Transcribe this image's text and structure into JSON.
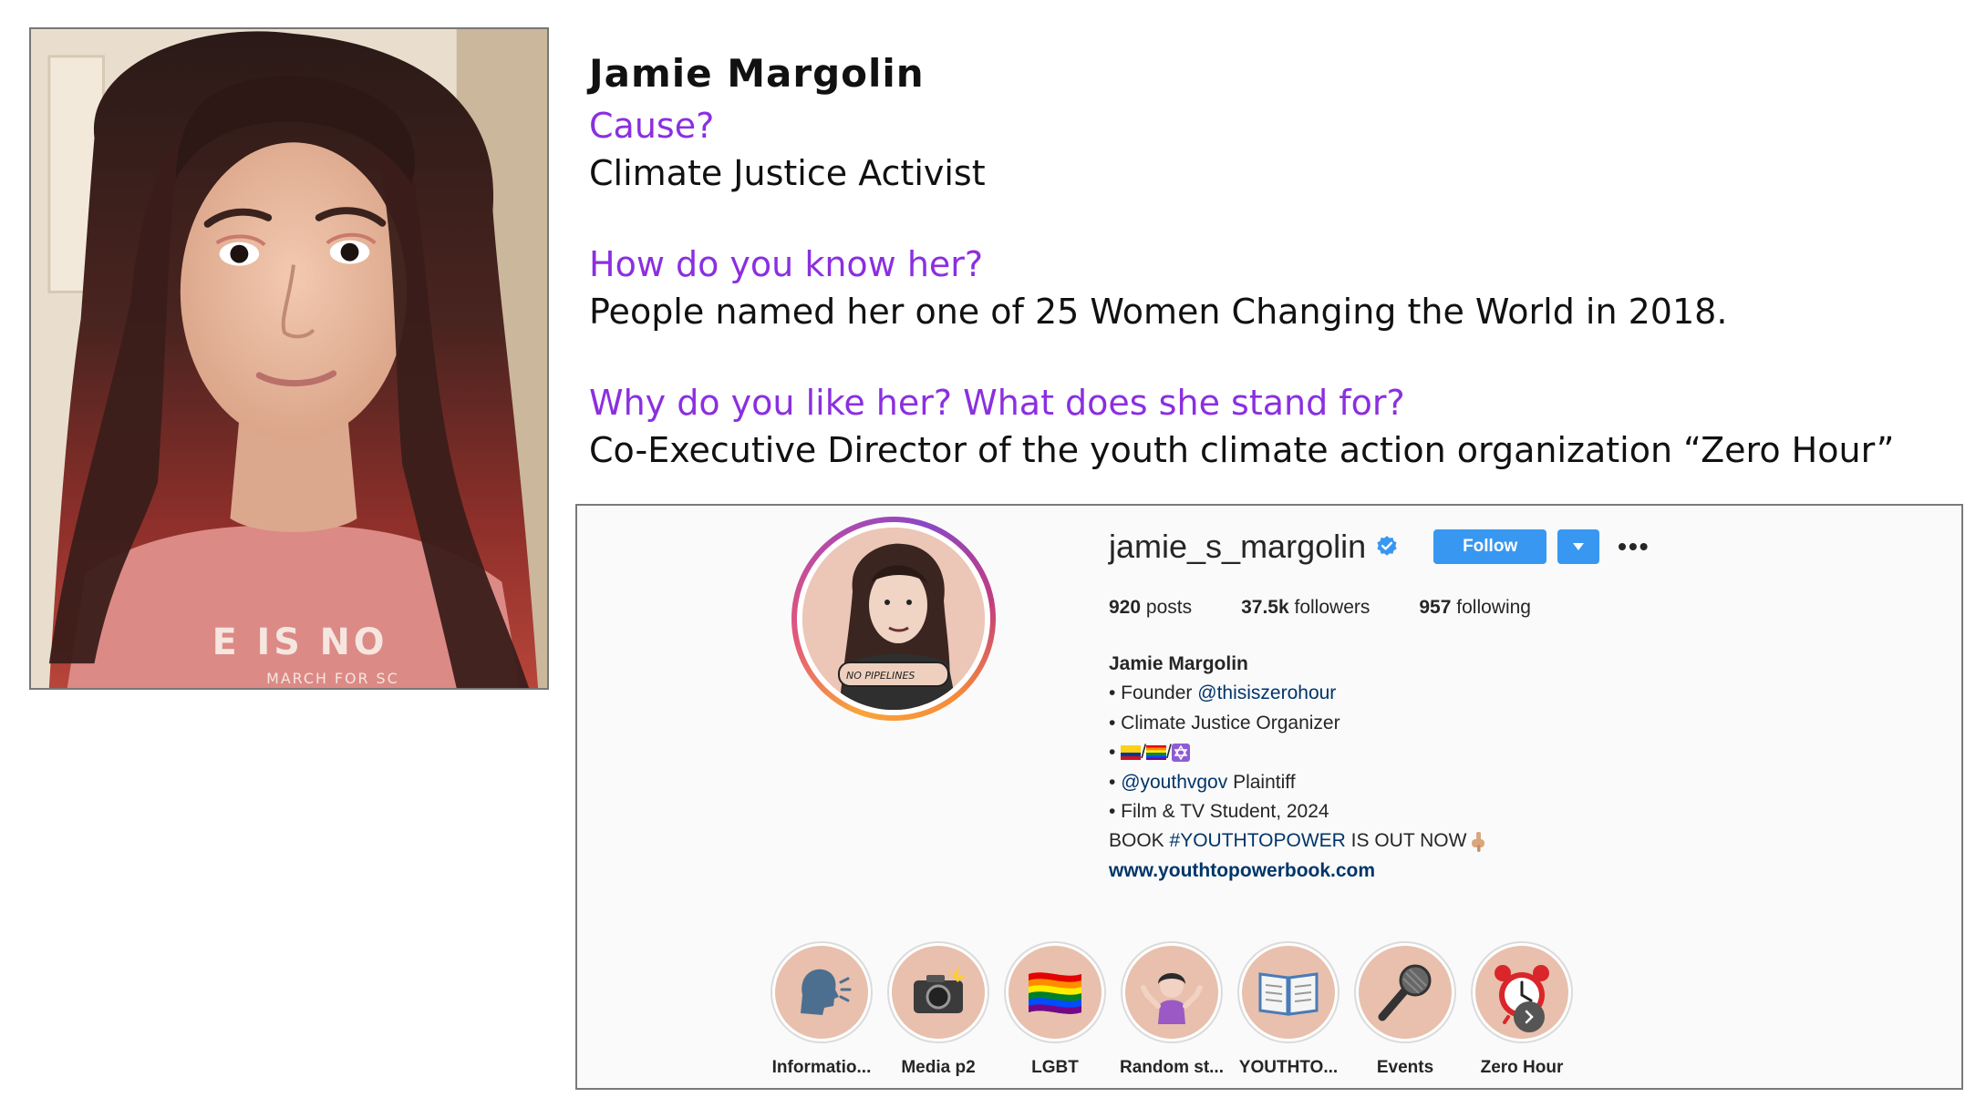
{
  "bio": {
    "name": "Jamie Margolin",
    "q1": "Cause?",
    "a1": "Climate Justice Activist",
    "q2": "How do you know her?",
    "a2": "People named her one of 25 Women Changing the World in 2018.",
    "q3": "Why do you like her? What does she stand for?",
    "a3": "Co-Executive Director of the youth climate action organization “Zero Hour”"
  },
  "photo": {
    "shirt_text": "E IS NO",
    "shirt_subtext": "MARCH FOR SC"
  },
  "instagram": {
    "username": "jamie_s_margolin",
    "follow_label": "Follow",
    "more_label": "•••",
    "stats": {
      "posts_count": "920",
      "posts_label": "posts",
      "followers_count": "37.5k",
      "followers_label": "followers",
      "following_count": "957",
      "following_label": "following"
    },
    "full_name": "Jamie Margolin",
    "bio_lines": {
      "founder_prefix": "• Founder ",
      "founder_handle": "@thisiszerohour",
      "organizer": "• Climate Justice Organizer",
      "flags_prefix": "• ",
      "flags_sep1": "/",
      "flags_sep2": "/",
      "plaintiff_prefix": "• ",
      "plaintiff_handle": "@youthvgov",
      "plaintiff_suffix": " Plaintiff",
      "student": "• Film & TV Student, 2024",
      "book_prefix": "BOOK ",
      "book_tag": "#YOUTHTOPOWER",
      "book_suffix": " IS OUT NOW",
      "url": "www.youthtopowerbook.com"
    },
    "avatar_text": "NO PIPELINES",
    "highlights": [
      {
        "label": "Informatio...",
        "emoji": "🗣️"
      },
      {
        "label": "Media p2",
        "emoji": "📸"
      },
      {
        "label": "LGBT",
        "emoji": "🏳️‍🌈"
      },
      {
        "label": "Random st...",
        "emoji": "🤷‍♀️"
      },
      {
        "label": "YOUTHTO...",
        "emoji": "📖"
      },
      {
        "label": "Events",
        "emoji": "🎤"
      },
      {
        "label": "Zero Hour",
        "emoji": "⏰"
      }
    ],
    "colors": {
      "accent_blue": "#3897f0",
      "link": "#003569",
      "question_purple": "#8b2fe0"
    }
  }
}
